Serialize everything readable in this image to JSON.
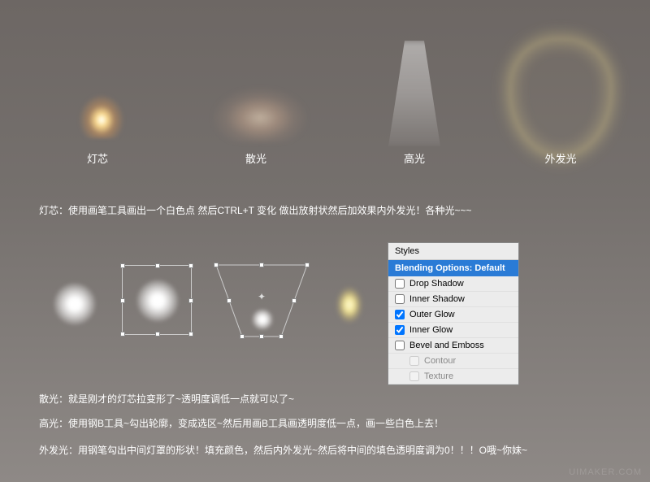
{
  "samples": {
    "wick_label": "灯芯",
    "scatter_label": "散光",
    "highlight_label": "高光",
    "outerglow_label": "外发光"
  },
  "descriptions": {
    "wick": "灯芯：使用画笔工具画出一个白色点 然后CTRL+T 变化 做出放射状然后加效果内外发光！各种光~~~",
    "scatter": "散光：就是刚才的灯芯拉变形了~透明度调低一点就可以了~",
    "highlight": "高光：使用钢B工具~勾出轮廓，变成选区~然后用画B工具画透明度低一点，画一些白色上去！",
    "outerglow": "外发光：用钢笔勾出中间灯罩的形状！填充颜色，然后内外发光~然后将中间的填色透明度调为0！！！O哦~你妹~"
  },
  "styles_panel": {
    "header": "Styles",
    "blending": "Blending Options: Default",
    "items": [
      {
        "label": "Drop Shadow",
        "checked": false,
        "sub": false
      },
      {
        "label": "Inner Shadow",
        "checked": false,
        "sub": false
      },
      {
        "label": "Outer Glow",
        "checked": true,
        "sub": false
      },
      {
        "label": "Inner Glow",
        "checked": true,
        "sub": false
      },
      {
        "label": "Bevel and Emboss",
        "checked": false,
        "sub": false
      },
      {
        "label": "Contour",
        "checked": false,
        "sub": true
      },
      {
        "label": "Texture",
        "checked": false,
        "sub": true
      }
    ]
  },
  "watermark": "UIMAKER.COM"
}
